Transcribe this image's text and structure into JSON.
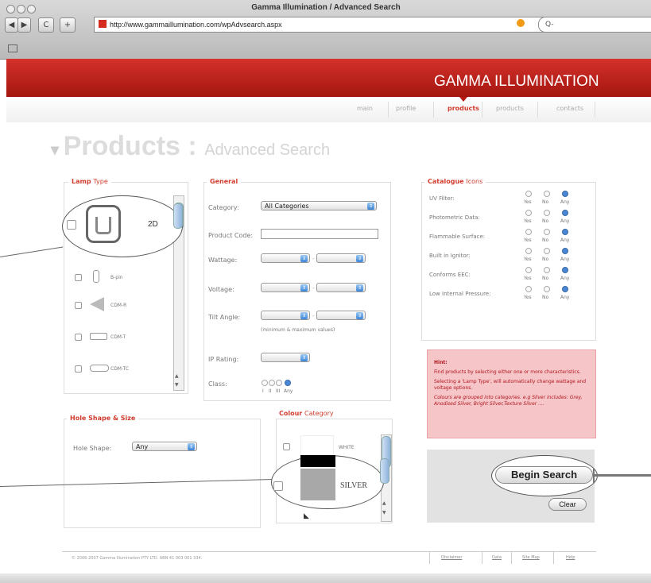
{
  "window": {
    "title": "Gamma Illumination / Advanced Search"
  },
  "browser": {
    "url": "http://www.gammaillumination.com/wpAdvsearch.aspx",
    "search_placeholder": "Q-",
    "back_label": "◀",
    "forward_label": "▶",
    "reload_label": "C",
    "add_label": "+"
  },
  "site": {
    "logo": "GAMMA ILLUMINATION",
    "nav": [
      "main",
      "profile",
      "products",
      "products",
      "contacts"
    ],
    "active_nav_color": "#d13b2d",
    "brand_color": "#c2241b"
  },
  "page": {
    "heading": "Products :",
    "subheading": "Advanced Search"
  },
  "lamp_type": {
    "title_bold": "Lamp",
    "title_light": "Type",
    "items": [
      {
        "label": "2D",
        "icon": "2d-lamp-icon"
      },
      {
        "label": "B-pin",
        "icon": "bulb-icon"
      },
      {
        "label": "CDM-R",
        "icon": "reflector-lamp-icon"
      },
      {
        "label": "CDM-T",
        "icon": "tube-lamp-icon"
      },
      {
        "label": "CDM-TC",
        "icon": "capsule-lamp-icon"
      }
    ]
  },
  "general": {
    "title": "General",
    "category_label": "Category:",
    "category_value": "All Categories",
    "product_code_label": "Product Code:",
    "wattage_label": "Wattage:",
    "voltage_label": "Voltage:",
    "tilt_angle_label": "Tilt Angle:",
    "tilt_hint": "(minimum & maximum values)",
    "ip_rating_label": "IP Rating:",
    "class_label": "Class:",
    "class_options": [
      "I",
      "II",
      "III",
      "Any"
    ],
    "class_selected": 3
  },
  "catalogue_icons": {
    "title_bold": "Catalogue",
    "title_light": "Icons",
    "options": [
      "Yes",
      "No",
      "Any"
    ],
    "rows": [
      {
        "label": "UV Filter:",
        "selected": 2
      },
      {
        "label": "Photometric Data:",
        "selected": 2
      },
      {
        "label": "Flammable Surface:",
        "selected": 2
      },
      {
        "label": "Built in Ignitor:",
        "selected": 2
      },
      {
        "label": "Conforms EEC:",
        "selected": 2
      },
      {
        "label": "Low Internal Pressure:",
        "selected": 2
      }
    ]
  },
  "hint": {
    "title": "Hint:",
    "lines": [
      "Find products by selecting either one or more characteristics.",
      "Selecting a 'Lamp Type', will automatically change wattage and voltage options.",
      "Colours are grouped into categories. e.g Silver includes: Grey, Anodised Silver, Bright Silver,Texture Silver ...."
    ]
  },
  "hole_shape": {
    "title": "Hole Shape & Size",
    "label": "Hole Shape:",
    "value": "Any"
  },
  "colour": {
    "title_bold": "Colour",
    "title_light": "Category",
    "items": [
      {
        "label": "WHITE",
        "swatch": "#ffffff"
      },
      {
        "label": "SILVER",
        "swatch": "#a8a8a8"
      }
    ]
  },
  "zoom_callouts": {
    "lamp_label": "2D",
    "colour_label": "SILVER",
    "search_label": "Begin Search"
  },
  "actions": {
    "search": "Begin Search",
    "clear": "Clear"
  },
  "footer": {
    "copyright": "© 2006-2007 Gamma Illumination PTY LTD. ABN 41 003 001 334.",
    "links": [
      "Disclaimer",
      "Data",
      "Site Map",
      "Help"
    ]
  }
}
